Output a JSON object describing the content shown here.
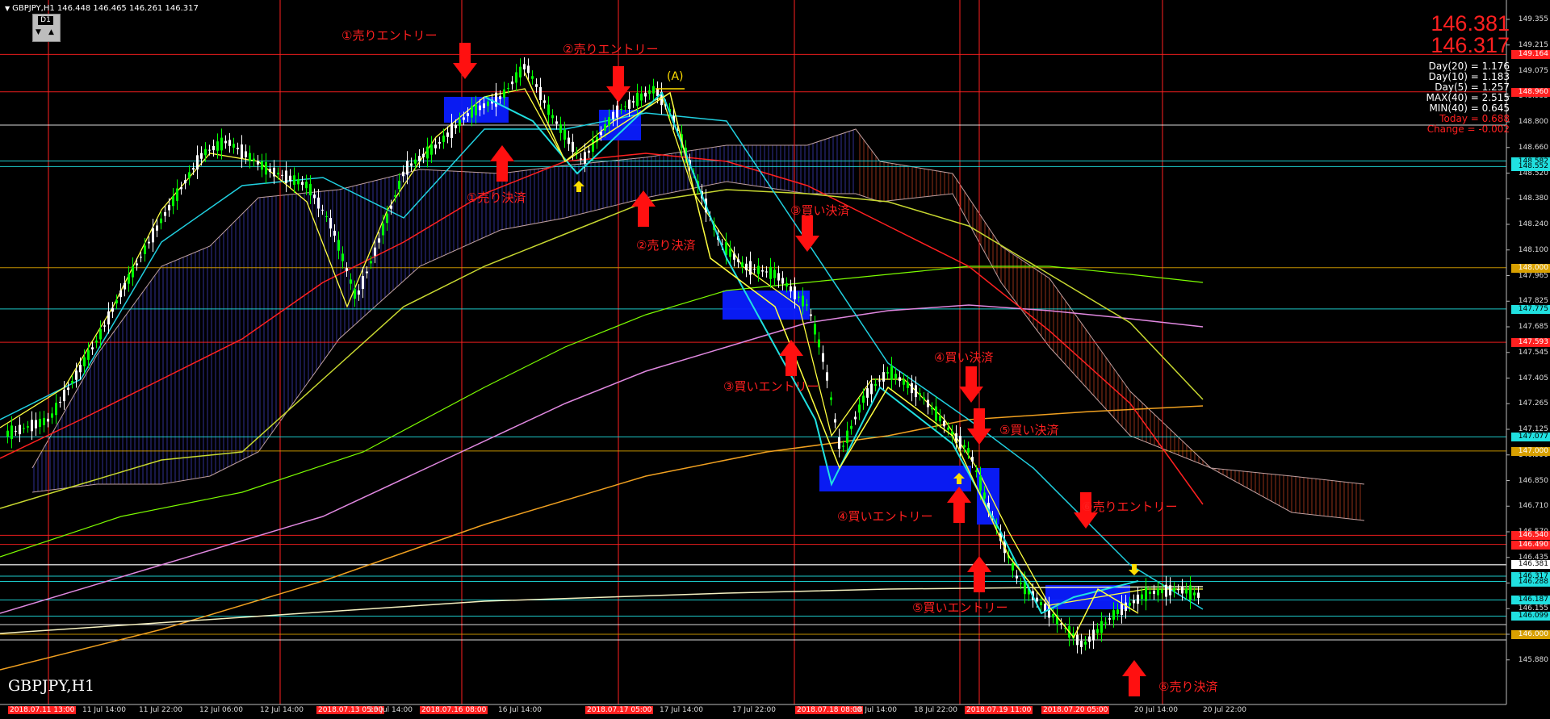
{
  "header": {
    "line": "GBPJPY,H1  146.448 146.465 146.261 146.317",
    "timeframe_button": "D1"
  },
  "symbol_label": "GBPJPY,H1",
  "bid_price": "146.381",
  "ask_price": "146.317",
  "stats": [
    {
      "text": "Day(20) = 1.176",
      "color": "#ffffff"
    },
    {
      "text": "Day(10) = 1.183",
      "color": "#ffffff"
    },
    {
      "text": "Day(5) = 1.257",
      "color": "#ffffff"
    },
    {
      "text": "MAX(40) = 2.515",
      "color": "#ffffff"
    },
    {
      "text": "MIN(40) = 0.645",
      "color": "#ffffff"
    },
    {
      "text": "Today = 0.688",
      "color": "#ff2020"
    },
    {
      "text": "Change = -0.002",
      "color": "#ff2020"
    }
  ],
  "price_axis": [
    "149.355",
    "149.215",
    "149.075",
    "148.935",
    "148.800",
    "148.660",
    "148.520",
    "148.380",
    "148.240",
    "148.100",
    "147.965",
    "147.825",
    "147.685",
    "147.545",
    "147.405",
    "147.265",
    "147.125",
    "146.990",
    "146.850",
    "146.710",
    "146.570",
    "146.435",
    "146.295",
    "146.155",
    "146.015",
    "145.880"
  ],
  "price_tags": [
    {
      "text": "149.164",
      "color": "#ff2020"
    },
    {
      "text": "148.960",
      "color": "#ff2020"
    },
    {
      "text": "148.582",
      "color": "#20e0e0"
    },
    {
      "text": "148.552",
      "color": "#20e0e0"
    },
    {
      "text": "148.000",
      "color": "#d8a000"
    },
    {
      "text": "147.775",
      "color": "#20e0e0"
    },
    {
      "text": "147.593",
      "color": "#ff2020"
    },
    {
      "text": "147.077",
      "color": "#20e0e0"
    },
    {
      "text": "147.000",
      "color": "#d8a000"
    },
    {
      "text": "146.540",
      "color": "#ff2020"
    },
    {
      "text": "146.490",
      "color": "#ff2020"
    },
    {
      "text": "146.381",
      "color": "#ffffff"
    },
    {
      "text": "146.317",
      "color": "#20e0e0"
    },
    {
      "text": "146.288",
      "color": "#20e0e0"
    },
    {
      "text": "146.187",
      "color": "#20e0e0"
    },
    {
      "text": "146.099",
      "color": "#20e0e0"
    },
    {
      "text": "146.000",
      "color": "#d8a000"
    }
  ],
  "time_axis": [
    {
      "text": "2018.07.11 13:00",
      "hl": true
    },
    {
      "text": "11 Jul 14:00",
      "hl": false
    },
    {
      "text": "11 Jul 22:00",
      "hl": false
    },
    {
      "text": "12 Jul 06:00",
      "hl": false
    },
    {
      "text": "12 Jul 14:00",
      "hl": false
    },
    {
      "text": "2018.07.13 05:00",
      "hl": true
    },
    {
      "text": "13 Jul 14:00",
      "hl": false
    },
    {
      "text": "2018.07.16 08:00",
      "hl": true
    },
    {
      "text": "16 Jul 14:00",
      "hl": false
    },
    {
      "text": "2018.07.17 05:00",
      "hl": true
    },
    {
      "text": "17 Jul 14:00",
      "hl": false
    },
    {
      "text": "17 Jul 22:00",
      "hl": false
    },
    {
      "text": "2018.07.18 08:00",
      "hl": true
    },
    {
      "text": "18 Jul 14:00",
      "hl": false
    },
    {
      "text": "18 Jul 22:00",
      "hl": false
    },
    {
      "text": "2018.07.19 11:00",
      "hl": true
    },
    {
      "text": "2018.07.20 05:00",
      "hl": true
    },
    {
      "text": "20 Jul 14:00",
      "hl": false
    },
    {
      "text": "20 Jul 22:00",
      "hl": false
    }
  ],
  "annotations": [
    {
      "text": "①売りエントリー"
    },
    {
      "text": "②売りエントリー"
    },
    {
      "text": "(A)"
    },
    {
      "text": "①売り決済"
    },
    {
      "text": "②売り決済"
    },
    {
      "text": "③買い決済"
    },
    {
      "text": "③買いエントリー"
    },
    {
      "text": "④買い決済"
    },
    {
      "text": "⑤買い決済"
    },
    {
      "text": "④買いエントリー"
    },
    {
      "text": "⑤買いエントリー"
    },
    {
      "text": "⑥売りエントリー"
    },
    {
      "text": "⑥売り決済"
    }
  ],
  "colors": {
    "background": "#000000",
    "bull_candle": "#00ff00",
    "bear_candle": "#ffffff",
    "annotation": "#ff2020",
    "zone": "#0a1cff",
    "cloud_bull": "#4040c0",
    "cloud_bear": "#c04020",
    "grid": "#cfcfcf"
  }
}
